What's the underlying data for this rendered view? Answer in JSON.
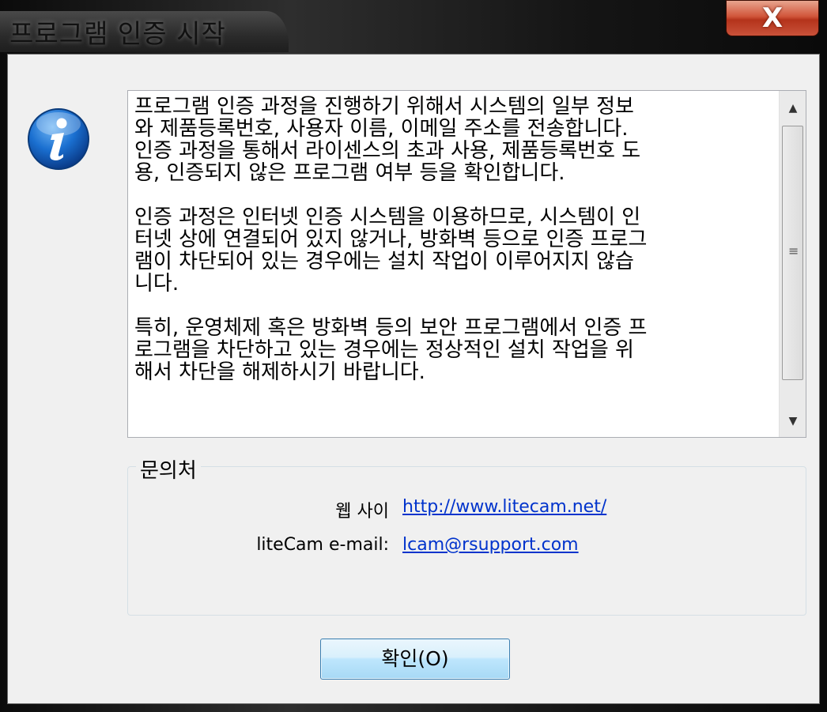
{
  "window": {
    "title": "프로그램 인증 시작",
    "close_label": "X"
  },
  "message": {
    "text": "프로그램 인증 과정을 진행하기 위해서 시스템의 일부 정보\n와 제품등록번호, 사용자 이름, 이메일 주소를 전송합니다.\n인증 과정을 통해서 라이센스의 초과 사용, 제품등록번호 도\n용, 인증되지 않은 프로그램 여부 등을 확인합니다.\n\n인증 과정은 인터넷 인증 시스템을 이용하므로, 시스템이 인\n터넷 상에 연결되어 있지 않거나, 방화벽 등으로 인증 프로그\n램이 차단되어 있는 경우에는 설치 작업이 이루어지지 않습\n니다.\n\n특히, 운영체제 혹은 방화벽 등의 보안 프로그램에서 인증 프\n로그램을 차단하고 있는 경우에는 정상적인 설치 작업을 위\n해서 차단을 해제하시기 바랍니다."
  },
  "scrollbar": {
    "up_icon": "▲",
    "down_icon": "▼",
    "grip_icon": "≡"
  },
  "contact": {
    "legend": "문의처",
    "website_label": "웹 사이",
    "website_url": "http://www.litecam.net/",
    "email_label": "liteCam e-mail:",
    "email_address": "lcam@rsupport.com"
  },
  "ok_button": {
    "label": "확인(O)"
  },
  "colors": {
    "link": "#0033cc",
    "close_button": "#c9523a",
    "info_icon": "#1a5fb4"
  }
}
